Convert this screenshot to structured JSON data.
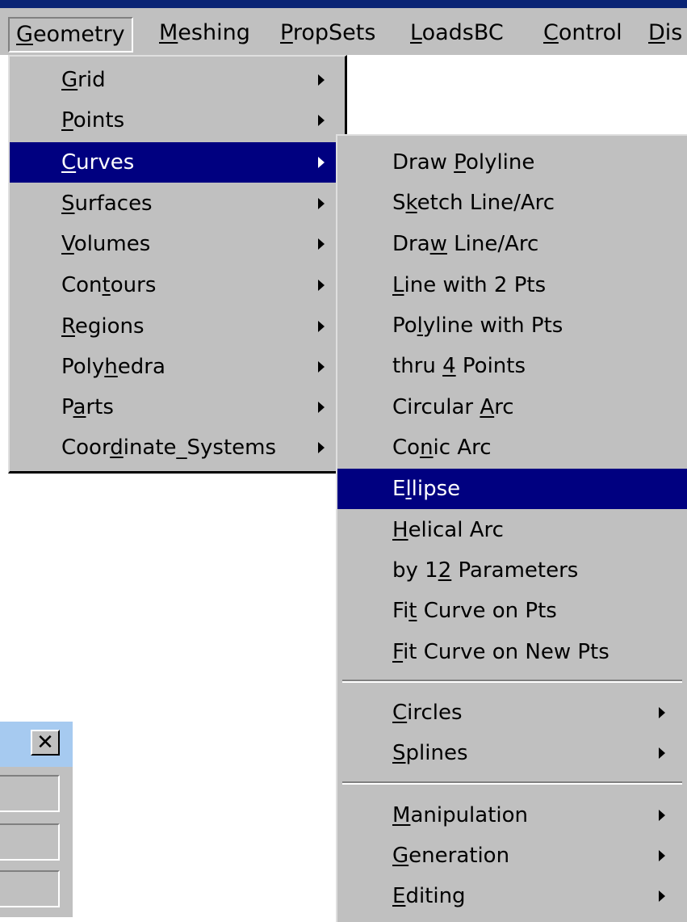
{
  "menubar": {
    "items": [
      {
        "pre": "",
        "u": "G",
        "post": "eometry"
      },
      {
        "pre": "",
        "u": "M",
        "post": "eshing"
      },
      {
        "pre": "",
        "u": "P",
        "post": "ropSets"
      },
      {
        "pre": "",
        "u": "L",
        "post": "oadsBC"
      },
      {
        "pre": "",
        "u": "C",
        "post": "ontrol"
      },
      {
        "pre": "",
        "u": "D",
        "post": "is"
      }
    ]
  },
  "geometry_menu": {
    "items": [
      {
        "pre": "",
        "u": "G",
        "post": "rid"
      },
      {
        "pre": "",
        "u": "P",
        "post": "oints"
      },
      {
        "pre": "",
        "u": "C",
        "post": "urves"
      },
      {
        "pre": "",
        "u": "S",
        "post": "urfaces"
      },
      {
        "pre": "",
        "u": "V",
        "post": "olumes"
      },
      {
        "pre": "Con",
        "u": "t",
        "post": "ours"
      },
      {
        "pre": "",
        "u": "R",
        "post": "egions"
      },
      {
        "pre": "Poly",
        "u": "h",
        "post": "edra"
      },
      {
        "pre": "P",
        "u": "a",
        "post": "rts"
      },
      {
        "pre": "Coor",
        "u": "d",
        "post": "inate_Systems"
      }
    ]
  },
  "curves_menu": {
    "items": [
      {
        "pre": "Draw ",
        "u": "P",
        "post": "olyline"
      },
      {
        "pre": "S",
        "u": "k",
        "post": "etch Line/Arc"
      },
      {
        "pre": "Dra",
        "u": "w",
        "post": " Line/Arc"
      },
      {
        "pre": "",
        "u": "L",
        "post": "ine with 2 Pts"
      },
      {
        "pre": "Po",
        "u": "l",
        "post": "yline with Pts"
      },
      {
        "pre": "thru ",
        "u": "4",
        "post": " Points"
      },
      {
        "pre": "Circular ",
        "u": "A",
        "post": "rc"
      },
      {
        "pre": "Co",
        "u": "n",
        "post": "ic Arc"
      },
      {
        "pre": "E",
        "u": "l",
        "post": "lipse"
      },
      {
        "pre": "",
        "u": "H",
        "post": "elical Arc"
      },
      {
        "pre": "by 1",
        "u": "2",
        "post": " Parameters"
      },
      {
        "pre": "Fi",
        "u": "t",
        "post": " Curve on Pts"
      },
      {
        "pre": "",
        "u": "F",
        "post": "it Curve on New Pts"
      },
      {
        "pre": "",
        "u": "C",
        "post": "ircles"
      },
      {
        "pre": "",
        "u": "S",
        "post": "plines"
      },
      {
        "pre": "",
        "u": "M",
        "post": "anipulation"
      },
      {
        "pre": "",
        "u": "G",
        "post": "eneration"
      },
      {
        "pre": "",
        "u": "E",
        "post": "diting"
      }
    ]
  },
  "dialog": {
    "close_glyph": "✕"
  }
}
